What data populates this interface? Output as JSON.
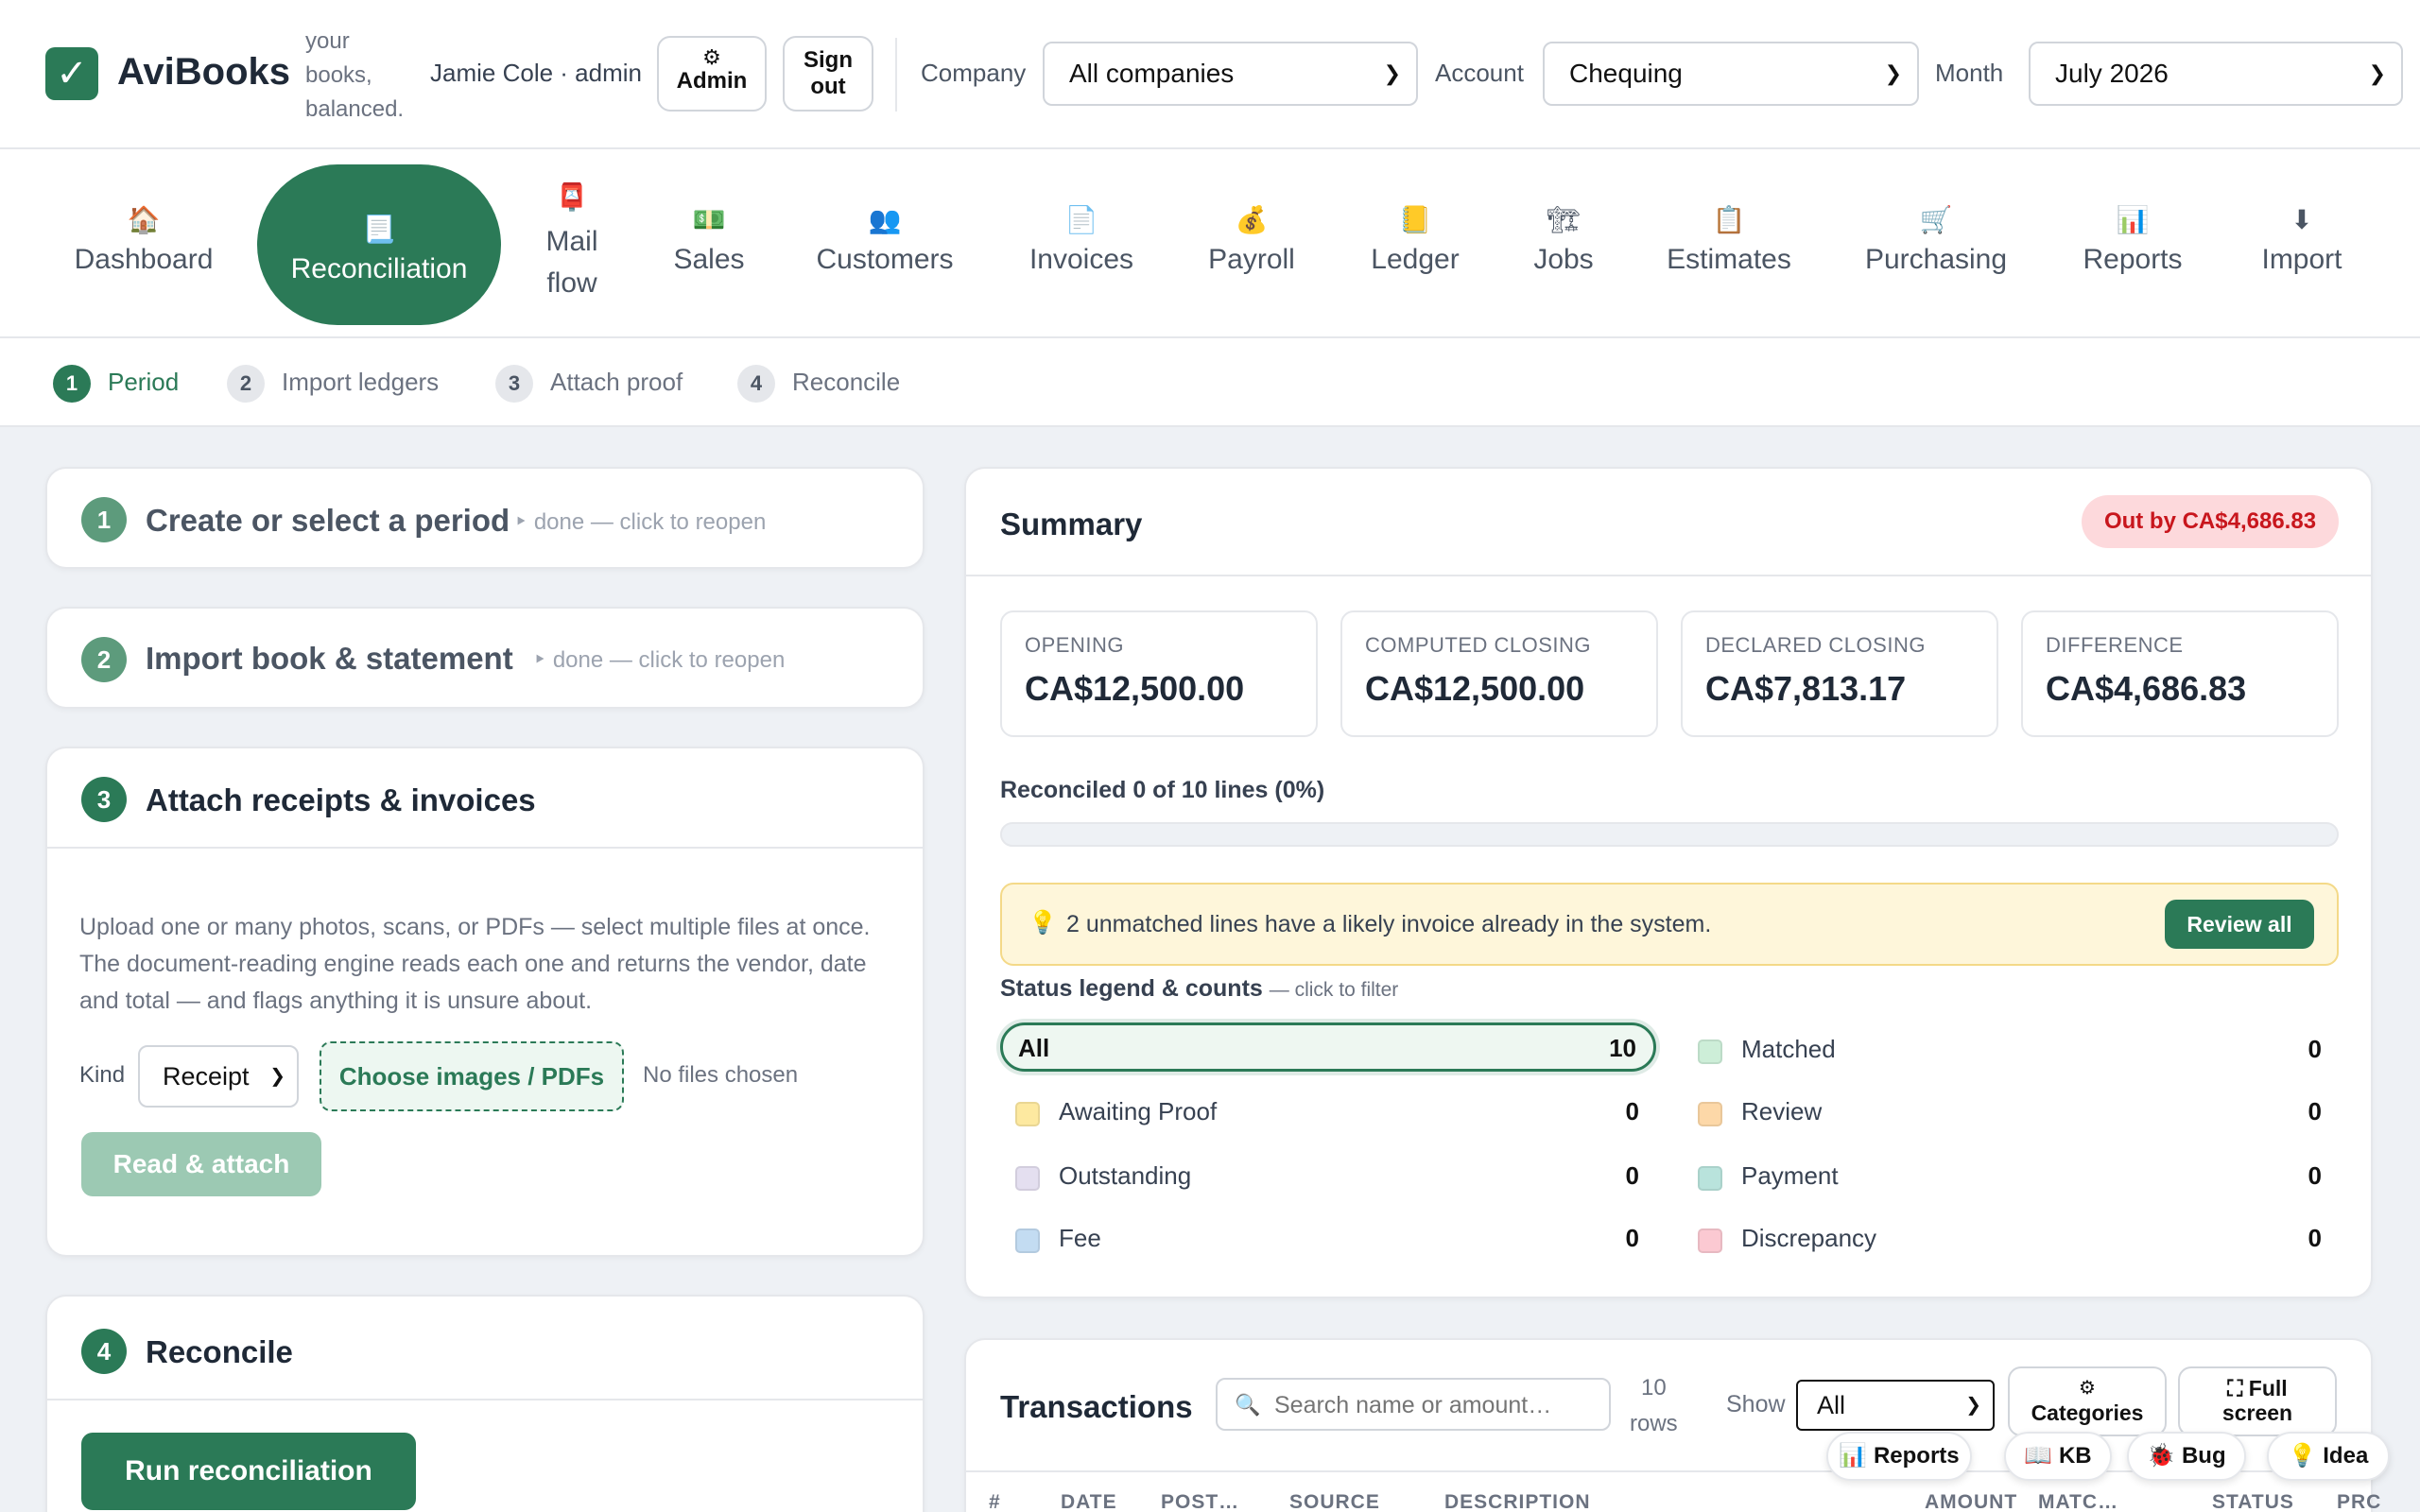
{
  "app": {
    "brand": "AviBooks",
    "logo_glyph": "✓",
    "tagline": "your books, balanced.",
    "user": "Jamie Cole · admin",
    "admin_icon": "⚙",
    "admin_label": "Admin",
    "signout_label": "Sign out"
  },
  "filters": {
    "company_label": "Company",
    "company_value": "All companies",
    "account_label": "Account",
    "account_value": "Chequing",
    "month_label": "Month",
    "month_value": "July 2026"
  },
  "nav": [
    {
      "icon": "🏠",
      "label": "Dashboard"
    },
    {
      "icon": "📃",
      "label": "Reconciliation",
      "active": true
    },
    {
      "icon": "📮",
      "label": "Mail flow"
    },
    {
      "icon": "💵",
      "label": "Sales"
    },
    {
      "icon": "👥",
      "label": "Customers"
    },
    {
      "icon": "📄",
      "label": "Invoices"
    },
    {
      "icon": "💰",
      "label": "Payroll"
    },
    {
      "icon": "📒",
      "label": "Ledger"
    },
    {
      "icon": "🏗",
      "label": "Jobs"
    },
    {
      "icon": "📋",
      "label": "Estimates"
    },
    {
      "icon": "🛒",
      "label": "Purchasing"
    },
    {
      "icon": "📊",
      "label": "Reports"
    },
    {
      "icon": "⬇",
      "label": "Import"
    }
  ],
  "steps": [
    {
      "n": "1",
      "label": "Period"
    },
    {
      "n": "2",
      "label": "Import ledgers"
    },
    {
      "n": "3",
      "label": "Attach proof"
    },
    {
      "n": "4",
      "label": "Reconcile"
    }
  ],
  "cards": {
    "c1": {
      "n": "1",
      "title": "Create or select a period",
      "note": "‣ done — click to reopen"
    },
    "c2": {
      "n": "2",
      "title": "Import book & statement",
      "note": "‣ done — click to reopen"
    },
    "c3": {
      "n": "3",
      "title": "Attach receipts & invoices",
      "desc": "Upload one or many photos, scans, or PDFs — select multiple files at once. The document-reading engine reads each one and returns the vendor, date and total — and flags anything it is unsure about.",
      "kind_label": "Kind",
      "kind_value": "Receipt",
      "choose_label": "Choose images / PDFs",
      "no_files": "No files chosen",
      "read_label": "Read & attach"
    },
    "c4": {
      "n": "4",
      "title": "Reconcile",
      "run_label": "Run reconciliation"
    }
  },
  "summary": {
    "title": "Summary",
    "status_pill": "Out by CA$4,686.83",
    "stats": [
      {
        "label": "OPENING",
        "value": "CA$12,500.00"
      },
      {
        "label": "COMPUTED CLOSING",
        "value": "CA$12,500.00"
      },
      {
        "label": "DECLARED CLOSING",
        "value": "CA$7,813.17"
      },
      {
        "label": "DIFFERENCE",
        "value": "CA$4,686.83"
      }
    ],
    "reconciled_text": "Reconciled 0 of 10 lines (0%)",
    "progress_fraction": 0,
    "hint_icon": "💡",
    "hint_text": "2 unmatched lines have a likely invoice already in the system.",
    "review_label": "Review all",
    "legend_title": "Status legend & counts",
    "legend_hint": "— click to filter",
    "legend": [
      {
        "label": "All",
        "count": "10",
        "color": "#ffffff"
      },
      {
        "label": "Matched",
        "count": "0",
        "color": "#cdeed8"
      },
      {
        "label": "Awaiting Proof",
        "count": "0",
        "color": "#fde9a0"
      },
      {
        "label": "Review",
        "count": "0",
        "color": "#fdd8a8"
      },
      {
        "label": "Outstanding",
        "count": "0",
        "color": "#e4dff0"
      },
      {
        "label": "Payment",
        "count": "0",
        "color": "#b9e3dc"
      },
      {
        "label": "Fee",
        "count": "0",
        "color": "#c3dcf2"
      },
      {
        "label": "Discrepancy",
        "count": "0",
        "color": "#fbc9d2"
      }
    ]
  },
  "transactions": {
    "title": "Transactions",
    "search_icon": "🔍",
    "search_placeholder": "Search name or amount…",
    "rows_line1": "10",
    "rows_line2": "rows",
    "show_label": "Show",
    "show_value": "All",
    "categories_icon": "⚙",
    "categories_label": "Categories",
    "fullscreen_icon": "⛶",
    "fullscreen_label1": "Full",
    "fullscreen_label2": "screen",
    "headers": [
      "#",
      "DATE",
      "POST…",
      "SOURCE",
      "DESCRIPTION",
      "AMOUNT",
      "MATC…",
      "STATUS",
      "PRC"
    ]
  },
  "float": [
    {
      "icon": "📊",
      "label": "Reports"
    },
    {
      "icon": "📖",
      "label": "KB"
    },
    {
      "icon": "🐞",
      "label": "Bug"
    },
    {
      "icon": "💡",
      "label": "Idea"
    }
  ],
  "colors": {
    "brand": "#2b7a57",
    "danger": "#c8161d"
  }
}
